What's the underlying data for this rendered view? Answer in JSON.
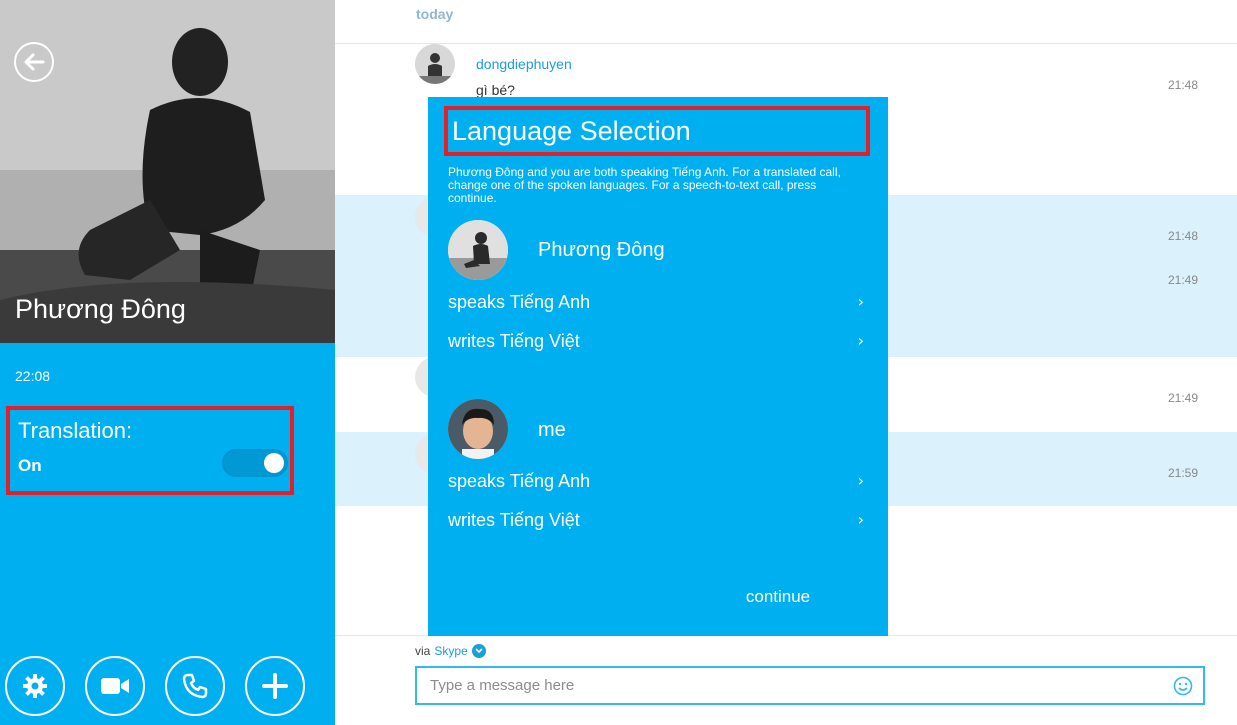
{
  "profile": {
    "name": "Phương Đông",
    "call_time": "22:08",
    "translation_label": "Translation:",
    "translation_state": "On",
    "translation_on": true
  },
  "actions": [
    "gear-icon",
    "video-icon",
    "phone-icon",
    "plus-icon"
  ],
  "conversation": {
    "day_label": "today",
    "messages": [
      {
        "sender": "dongdiephuyen",
        "text": "gì bé?",
        "time": "21:48"
      },
      {
        "time": "21:48"
      },
      {
        "time": "21:49"
      },
      {
        "time": "21:49"
      },
      {
        "time": "21:59"
      }
    ],
    "via_label": "via",
    "via_service": "Skype",
    "input_placeholder": "Type a message here"
  },
  "dialog": {
    "title": "Language Selection",
    "description": "Phương Đông and you are both speaking Tiếng Anh. For a translated call, change one of the spoken languages. For a speech-to-text call, press continue.",
    "people": [
      {
        "name": "Phương Đông",
        "speaks": "speaks Tiếng Anh",
        "writes": "writes Tiếng Việt"
      },
      {
        "name": "me",
        "speaks": "speaks Tiếng Anh",
        "writes": "writes Tiếng Việt"
      }
    ],
    "continue_label": "continue"
  },
  "colors": {
    "accent": "#00aff0",
    "highlight_row": "#dbf1fc",
    "annotation_red": "#e0202b",
    "link": "#1a9fd9"
  }
}
